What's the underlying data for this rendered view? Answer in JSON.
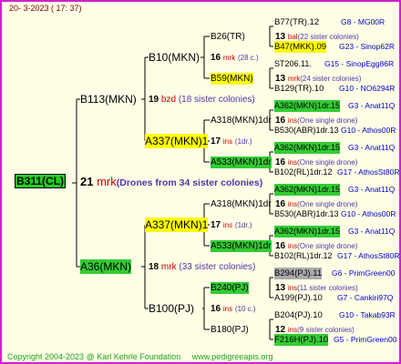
{
  "date": "20- 3-2023 ( 17: 37)",
  "footer": {
    "copyright": "Copyright 2004-2023 @ Karl Kehrle Foundation",
    "url": "www.pedigreeapis.org"
  },
  "root": {
    "name": "B311(CL)",
    "count": "21",
    "mark": "mrk",
    "note": "(Drones from 34 sister colonies)"
  },
  "n1": {
    "name": "B113(MKN)",
    "count": "19",
    "mark": "bzd",
    "note": "(18 sister colonies)"
  },
  "n2": {
    "name": "A36(MKN)",
    "count": "18",
    "mark": "mrk",
    "note": "(33 sister colonies)"
  },
  "n11": {
    "name": "B10(MKN)",
    "count": "16",
    "mark": "mrk",
    "note": "(28 c.)"
  },
  "n12": {
    "name": "A337(MKN)1",
    "count": "17",
    "mark": "ins",
    "note": "(1dr.)"
  },
  "n21": {
    "name": "A337(MKN)1",
    "count": "17",
    "mark": "ins",
    "note": "(1dr.)"
  },
  "n22": {
    "name": "B100(PJ)",
    "count": "16",
    "mark": "ins",
    "note": "(10 c.)"
  },
  "g111": {
    "name": "B26(TR)",
    "count": "13",
    "mark": "bal",
    "note": "(22 sister colonies)"
  },
  "g112": {
    "name": "B59(MKN)",
    "count": "13",
    "mark": "mrk",
    "note": "(24 sister colonies)"
  },
  "g121": {
    "name": "A318(MKN)1dr",
    "count": "16",
    "mark": "ins",
    "note": "(One single drone)"
  },
  "g122": {
    "name": "A533(MKN)1dr",
    "count": "16",
    "mark": "ins",
    "note": "(One single drone)"
  },
  "g211": {
    "name": "A318(MKN)1dr",
    "count": "16",
    "mark": "ins",
    "note": "(One single drone)"
  },
  "g212": {
    "name": "A533(MKN)1dr",
    "count": "16",
    "mark": "ins",
    "note": "(One single drone)"
  },
  "g221": {
    "name": "B240(PJ)",
    "count": "13",
    "mark": "ins",
    "note": "(11 sister colonies)"
  },
  "g222": {
    "name": "B180(PJ)",
    "count": "12",
    "mark": "ins",
    "note": "(9 sister colonies)"
  },
  "leaves": [
    {
      "name": "B77(TR).12",
      "info": "G8 - MG00R"
    },
    {
      "name": "B47(MKK).09",
      "info": "G23 - Sinop62R"
    },
    {
      "name": "ST206.11.",
      "info": "G15 - SinopEgg86R"
    },
    {
      "name": "B129(TR).10",
      "info": "G10 - NO6294R"
    },
    {
      "name": "A362(MKN)1dr.15",
      "info": "G3 - Anat11Q"
    },
    {
      "name": "B530(ABR)1dr.13",
      "info": "G10 - Athos00R"
    },
    {
      "name": "A362(MKN)1dr.15",
      "info": "G3 - Anat11Q"
    },
    {
      "name": "B102(RL)1dr.12",
      "info": "G17 - AthosSt80R"
    },
    {
      "name": "A362(MKN)1dr.15",
      "info": "G3 - Anat11Q"
    },
    {
      "name": "B530(ABR)1dr.13",
      "info": "G10 - Athos00R"
    },
    {
      "name": "A362(MKN)1dr.15",
      "info": "G3 - Anat11Q"
    },
    {
      "name": "B102(RL)1dr.12",
      "info": "G17 - AthosSt80R"
    },
    {
      "name": "B294(PJ).11",
      "info": "G6 - PrimGreen00"
    },
    {
      "name": "A199(PJ).10",
      "info": "G7 - Cankiri97Q"
    },
    {
      "name": "B204(PJ).10",
      "info": "G10 - Takab93R"
    },
    {
      "name": "F216H(PJ).10",
      "info": "G5 - PrimGreen00"
    }
  ]
}
